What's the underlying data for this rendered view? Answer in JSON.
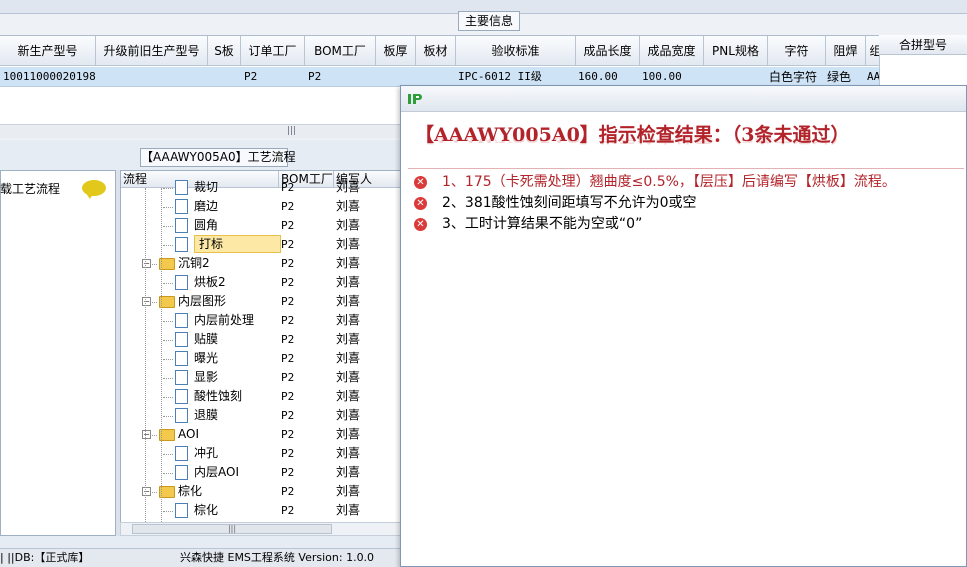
{
  "top": {
    "group_title": "主要信息",
    "columns": [
      "新生产型号",
      "升级前旧生产型号",
      "S板",
      "订单工厂",
      "BOM工厂",
      "板厚",
      "板材",
      "验收标准",
      "成品长度",
      "成品宽度",
      "PNL规格",
      "字符",
      "阻焊",
      "组"
    ],
    "row": {
      "model": "10011000020198",
      "order_factory": "P2",
      "bom_factory": "P2",
      "acceptance": "IPC-6012 II级",
      "length": "160.00",
      "width": "100.00",
      "char": "白色字符",
      "solder": "绿色",
      "extra": "AA"
    },
    "scroll_grip": "|||",
    "right_header": "合拼型号"
  },
  "flow": {
    "group_title": "【AAAWY005A0】工艺流程",
    "left_title": "载工艺流程",
    "headers": {
      "process": "流程",
      "bom": "BOM工厂",
      "author": "编写人"
    },
    "rows": [
      {
        "name": "裁切",
        "bom": "P2",
        "author": "刘喜",
        "type": "doc"
      },
      {
        "name": "磨边",
        "bom": "P2",
        "author": "刘喜",
        "type": "doc"
      },
      {
        "name": "圆角",
        "bom": "P2",
        "author": "刘喜",
        "type": "doc"
      },
      {
        "name": "打标",
        "bom": "P2",
        "author": "刘喜",
        "type": "doc"
      },
      {
        "name": "沉铜2",
        "bom": "P2",
        "author": "刘喜",
        "type": "folder"
      },
      {
        "name": "烘板2",
        "bom": "P2",
        "author": "刘喜",
        "type": "doc"
      },
      {
        "name": "内层图形",
        "bom": "P2",
        "author": "刘喜",
        "type": "folder"
      },
      {
        "name": "内层前处理",
        "bom": "P2",
        "author": "刘喜",
        "type": "doc"
      },
      {
        "name": "贴膜",
        "bom": "P2",
        "author": "刘喜",
        "type": "doc"
      },
      {
        "name": "曝光",
        "bom": "P2",
        "author": "刘喜",
        "type": "doc"
      },
      {
        "name": "显影",
        "bom": "P2",
        "author": "刘喜",
        "type": "doc"
      },
      {
        "name": "酸性蚀刻",
        "bom": "P2",
        "author": "刘喜",
        "type": "doc"
      },
      {
        "name": "退膜",
        "bom": "P2",
        "author": "刘喜",
        "type": "doc"
      },
      {
        "name": "AOI",
        "bom": "P2",
        "author": "刘喜",
        "type": "folder"
      },
      {
        "name": "冲孔",
        "bom": "P2",
        "author": "刘喜",
        "type": "doc"
      },
      {
        "name": "内层AOI",
        "bom": "P2",
        "author": "刘喜",
        "type": "doc"
      },
      {
        "name": "棕化",
        "bom": "P2",
        "author": "刘喜",
        "type": "folder"
      },
      {
        "name": "棕化",
        "bom": "P2",
        "author": "刘喜",
        "type": "doc"
      }
    ],
    "selected_index": 3,
    "scroll_grip": "|||"
  },
  "status": {
    "text": "| ||DB:【正式库】",
    "app": "兴森快捷 EMS工程系统 Version: 1.0.0"
  },
  "dialog": {
    "heading": "【AAAWY005A0】指示检查结果：（3条未通过）",
    "errors": [
      {
        "text": "1、175（卡死需处理）翘曲度≤0.5%，【层压】后请编写【烘板】流程。",
        "color": "#b3232a"
      },
      {
        "text": "2、381酸性蚀刻间距填写不允许为0或空",
        "color": "#000000"
      },
      {
        "text": "3、工时计算结果不能为空或“0”",
        "color": "#000000"
      }
    ],
    "error_icon": "error-x-icon"
  },
  "colors": {
    "accent_red": "#b3232a",
    "selection": "#cfe3f6",
    "tree_selection": "#fde8a6"
  }
}
